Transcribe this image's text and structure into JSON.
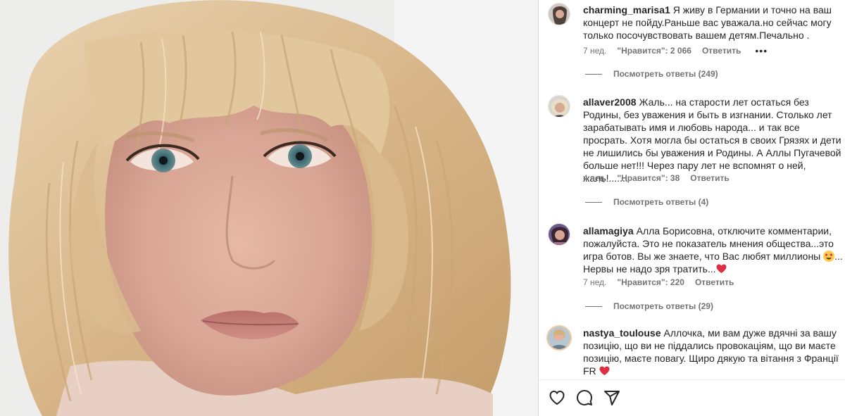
{
  "comments": [
    {
      "username": "charming_marisa1",
      "text": "Я живу в Германии и точно на ваш концерт не пойду.Раньше вас уважала.но сейчас могу только посочувствовать вашем детям.Печально .",
      "time": "7 нед.",
      "likes": "\"Нравится\": 2 066",
      "reply_label": "Ответить",
      "more_label": "•••",
      "replies_label": "Посмотреть ответы (249)"
    },
    {
      "username": "allaver2008",
      "text": "Жаль... на старости лет остаться без Родины, без уважения и быть в изгнании. Столько лет зарабатывать имя и любовь народа... и так все просрать. Хотя могла бы остаться в своих Грязях и дети не лишились бы уважения и Родины. А Аллы Пугачевой больше нет!!! Через пару лет не вспомнят о ней, жаль!.......",
      "time": "4 нед.",
      "likes": "\"Нравится\": 38",
      "reply_label": "Ответить",
      "replies_label": "Посмотреть ответы (4)"
    },
    {
      "username": "allamagiya",
      "text_a": "Алла Борисовна, отключите комментарии, пожалуйста. Это не показатель мнения общества...это игра ботов. Вы же знаете, что Вас любят миллионы",
      "text_b": "... Нервы не надо зря тратить...",
      "time": "7 нед.",
      "likes": "\"Нравится\": 220",
      "reply_label": "Ответить",
      "replies_label": "Посмотреть ответы (29)"
    },
    {
      "username": "nastya_toulouse",
      "text": "Аллочка, ми вам дуже вдячні за вашу позицію, що ви не піддались провокаціям, що ви маєте позицію, маєте повагу. Щиро дякую та вітання з Франції FR"
    }
  ],
  "icons": {
    "like": "heart-outline-icon",
    "comment": "speech-bubble-icon",
    "share": "paper-plane-icon",
    "heart_emoji": "red-heart-emoji",
    "love_emoji": "smiling-face-with-heart-eyes-emoji"
  },
  "colors": {
    "text": "#262626",
    "secondary": "#737373",
    "divider": "#dbdbdb",
    "heart": "#e0245e"
  }
}
